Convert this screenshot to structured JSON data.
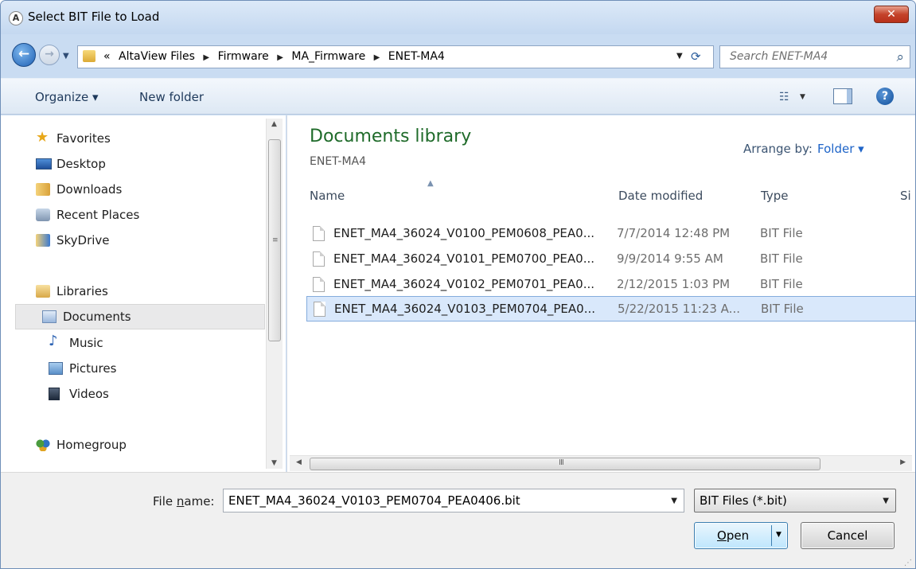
{
  "window": {
    "title": "Select BIT File to Load",
    "app_icon_glyph": "A",
    "close_glyph": "✕"
  },
  "address": {
    "crumbs": [
      "«",
      "AltaView Files",
      "Firmware",
      "MA_Firmware",
      "ENET-MA4"
    ],
    "separator": "▶",
    "dropdown_glyph": "▼",
    "refresh_glyph": "⟳"
  },
  "search": {
    "placeholder": "Search ENET-MA4",
    "icon_glyph": "⌕"
  },
  "toolbar": {
    "organize_label": "Organize ▾",
    "new_folder_label": "New folder",
    "views_glyph": "☷",
    "views_drop": "▼",
    "help_glyph": "?"
  },
  "sidebar": {
    "favorites_label": "Favorites",
    "items_favorites": [
      "Desktop",
      "Downloads",
      "Recent Places",
      "SkyDrive"
    ],
    "libraries_label": "Libraries",
    "items_libraries": [
      "Documents",
      "Music",
      "Pictures",
      "Videos"
    ],
    "homegroup_label": "Homegroup"
  },
  "content": {
    "library_title": "Documents library",
    "library_subtitle": "ENET-MA4",
    "arrange_label": "Arrange by:",
    "arrange_value": "Folder ▾",
    "columns": [
      "Name",
      "Date modified",
      "Type",
      "Si"
    ],
    "sort_glyph": "▲",
    "files": [
      {
        "name": "ENET_MA4_36024_V0100_PEM0608_PEA0...",
        "date": "7/7/2014 12:48 PM",
        "type": "BIT File"
      },
      {
        "name": "ENET_MA4_36024_V0101_PEM0700_PEA0...",
        "date": "9/9/2014 9:55 AM",
        "type": "BIT File"
      },
      {
        "name": "ENET_MA4_36024_V0102_PEM0701_PEA0...",
        "date": "2/12/2015 1:03 PM",
        "type": "BIT File"
      },
      {
        "name": "ENET_MA4_36024_V0103_PEM0704_PEA0...",
        "date": "5/22/2015 11:23 A...",
        "type": "BIT File"
      }
    ],
    "selected_index": 3
  },
  "scrollbars": {
    "up": "▲",
    "down": "▼",
    "left": "◀",
    "right": "▶",
    "v_grip": "≡",
    "h_grip": "III"
  },
  "footer": {
    "file_name_label_prefix": "File ",
    "file_name_label_accel": "n",
    "file_name_label_suffix": "ame:",
    "file_name_value": "ENET_MA4_36024_V0103_PEM0704_PEA0406.bit",
    "dropdown_glyph": "▼",
    "filter_value": "BIT Files (*.bit)",
    "open_accel": "O",
    "open_rest": "pen",
    "open_drop": "▼",
    "cancel_label": "Cancel",
    "grip_glyph": "⋰"
  }
}
